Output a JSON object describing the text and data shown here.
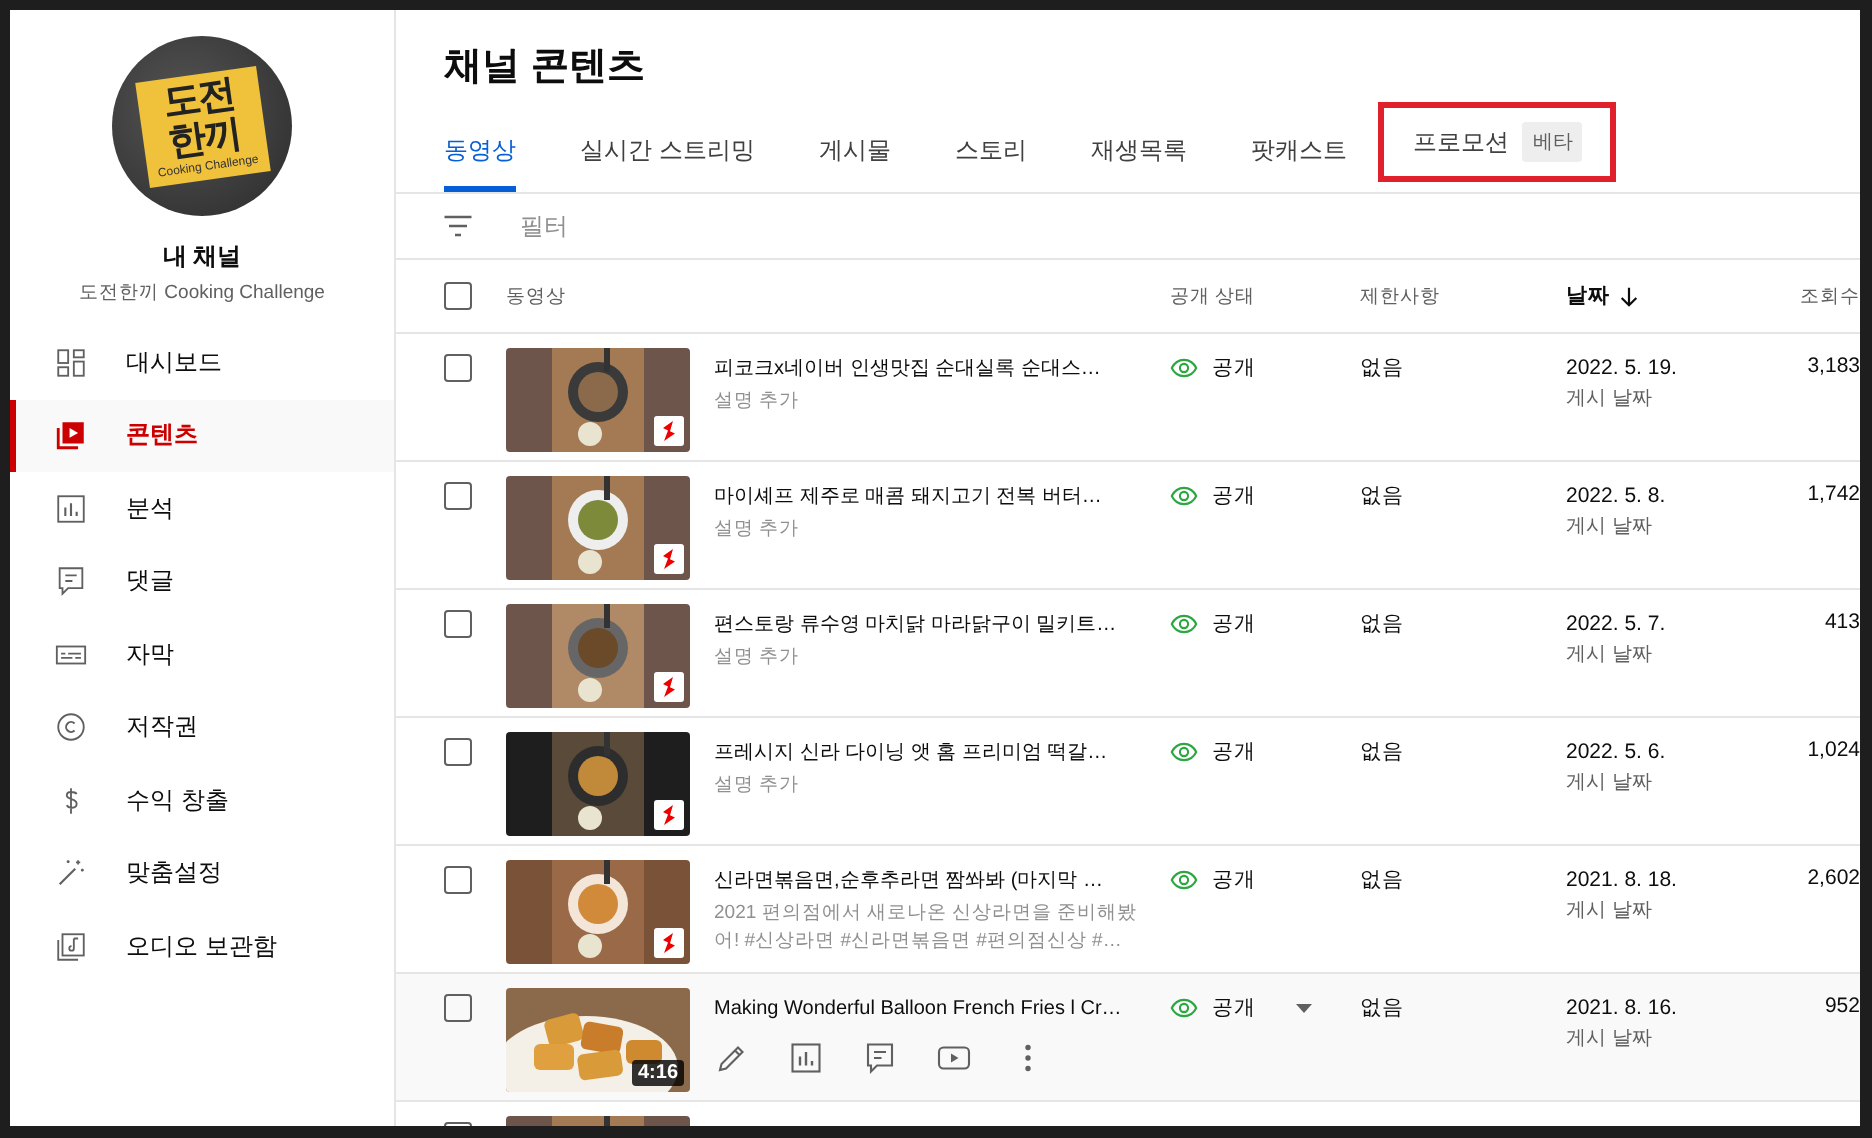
{
  "channel": {
    "avatar": {
      "line1": "도전",
      "line2": "한끼",
      "tagline": "Cooking Challenge"
    },
    "title": "내 채널",
    "name": "도전한끼 Cooking Challenge"
  },
  "sidebar": {
    "items": [
      {
        "label": "대시보드",
        "kind": "dashboard",
        "selected": false
      },
      {
        "label": "콘텐츠",
        "kind": "content",
        "selected": true
      },
      {
        "label": "분석",
        "kind": "analytics",
        "selected": false
      },
      {
        "label": "댓글",
        "kind": "comments",
        "selected": false
      },
      {
        "label": "자막",
        "kind": "subtitles",
        "selected": false
      },
      {
        "label": "저작권",
        "kind": "copyright",
        "selected": false
      },
      {
        "label": "수익 창출",
        "kind": "earn",
        "selected": false
      },
      {
        "label": "맞춤설정",
        "kind": "customize",
        "selected": false
      },
      {
        "label": "오디오 보관함",
        "kind": "audio",
        "selected": false
      }
    ]
  },
  "page_title": "채널 콘텐츠",
  "tabs": [
    {
      "label": "동영상",
      "selected": true
    },
    {
      "label": "실시간 스트리밍",
      "selected": false
    },
    {
      "label": "게시물",
      "selected": false
    },
    {
      "label": "스토리",
      "selected": false
    },
    {
      "label": "재생목록",
      "selected": false
    },
    {
      "label": "팟캐스트",
      "selected": false
    },
    {
      "label": "프로모션",
      "selected": false,
      "badge": "베타",
      "highlighted": true
    }
  ],
  "filter": {
    "placeholder": "필터"
  },
  "table": {
    "select_all": {
      "checked": false
    },
    "columns": [
      {
        "label": "동영상",
        "sorted": false
      },
      {
        "label": "공개 상태",
        "sorted": false
      },
      {
        "label": "제한사항",
        "sorted": false
      },
      {
        "label": "날짜",
        "sorted": true
      },
      {
        "label": "조회수",
        "sorted": false
      }
    ],
    "rows": [
      {
        "kind": "video",
        "checked": false,
        "hovered": false,
        "shorts": true,
        "title": "피코크x네이버 인생맛집 순대실록 순대스…",
        "description": "설명 추가",
        "visibility": "공개",
        "restrictions": "없음",
        "date": "2022. 5. 19.",
        "date_label": "게시 날짜",
        "views": "3,183"
      },
      {
        "kind": "video",
        "checked": false,
        "hovered": false,
        "shorts": true,
        "title": "마이셰프 제주로 매콤 돼지고기 전복 버터…",
        "description": "설명 추가",
        "visibility": "공개",
        "restrictions": "없음",
        "date": "2022. 5. 8.",
        "date_label": "게시 날짜",
        "views": "1,742"
      },
      {
        "kind": "video",
        "checked": false,
        "hovered": false,
        "shorts": true,
        "title": "편스토랑 류수영 마치닭 마라닭구이 밀키트…",
        "description": "설명 추가",
        "visibility": "공개",
        "restrictions": "없음",
        "date": "2022. 5. 7.",
        "date_label": "게시 날짜",
        "views": "413"
      },
      {
        "kind": "video",
        "checked": false,
        "hovered": false,
        "shorts": true,
        "title": "프레시지 신라 다이닝 앳 홈 프리미엄 떡갈…",
        "description": "설명 추가",
        "visibility": "공개",
        "restrictions": "없음",
        "date": "2022. 5. 6.",
        "date_label": "게시 날짜",
        "views": "1,024"
      },
      {
        "kind": "video",
        "checked": false,
        "hovered": false,
        "shorts": true,
        "title": "신라면볶음면,순후추라면 짬쏴봐 (마지막 …",
        "description": "2021 편의점에서 새로나온 신상라면을 준비해봤어! #신상라면 #신라면볶음면 #편의점신상 #…",
        "visibility": "공개",
        "restrictions": "없음",
        "date": "2021. 8. 18.",
        "date_label": "게시 날짜",
        "views": "2,602"
      },
      {
        "kind": "video",
        "checked": false,
        "hovered": true,
        "shorts": false,
        "duration": "4:16",
        "title": "Making Wonderful Balloon French Fries l Cr…",
        "visibility": "공개",
        "restrictions": "없음",
        "date": "2021. 8. 16.",
        "date_label": "게시 날짜",
        "views": "952"
      },
      {
        "kind": "cut",
        "checked": false
      }
    ]
  }
}
